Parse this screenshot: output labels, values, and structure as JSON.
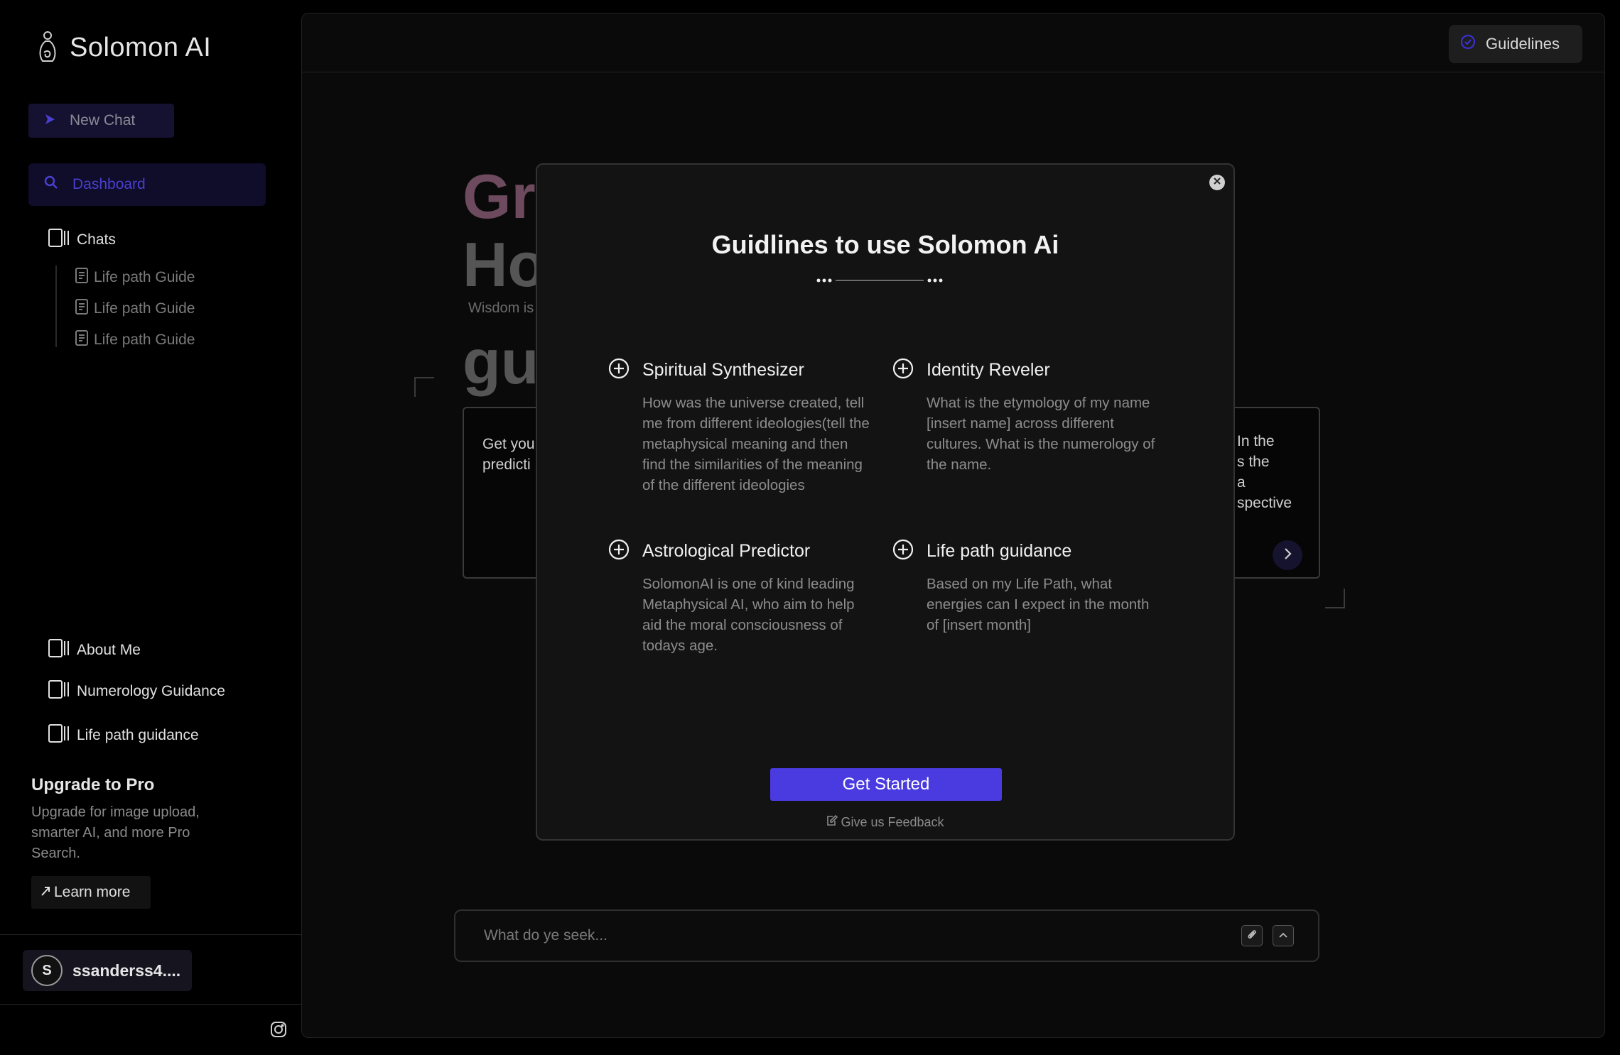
{
  "brand": {
    "title": "Solomon AI"
  },
  "sidebar": {
    "new_chat": "New Chat",
    "dashboard": "Dashboard",
    "chats_label": "Chats",
    "chat_items": [
      "Life path Guide",
      "Life path Guide",
      "Life path Guide"
    ],
    "bottom_items": [
      "About Me",
      "Numerology Guidance",
      "Life path guidance"
    ],
    "upgrade": {
      "title": "Upgrade to Pro",
      "description": "Upgrade for image upload, smarter AI, and more Pro Search.",
      "learn_more": "Learn more"
    },
    "user": {
      "initial": "S",
      "name": "ssanderss4...."
    }
  },
  "header": {
    "guidelines_button": "Guidelines"
  },
  "hero": {
    "line1": "Gr",
    "line2": "Ho",
    "subtitle": "Wisdom is",
    "line3": "gu"
  },
  "cards": {
    "left_text": "Get you\npredicti",
    "right_text": "In the\ns the\na\nspective"
  },
  "chat_input": {
    "placeholder": "What do ye seek..."
  },
  "modal": {
    "title": "Guidlines to use Solomon Ai",
    "features": [
      {
        "title": "Spiritual Synthesizer",
        "description": "How was the universe created, tell me from different ideologies(tell the metaphysical meaning  and then find the similarities of the meaning of the different ideologies"
      },
      {
        "title": "Identity Reveler",
        "description": "What is the etymology of my name [insert name] across different cultures. What is the numerology of the name."
      },
      {
        "title": "Astrological Predictor",
        "description": "SolomonAI is one of kind leading Metaphysical AI, who aim to help aid the moral consciousness of todays age."
      },
      {
        "title": "Life path guidance",
        "description": "Based on my Life Path, what energies can I expect in the month of [insert month]"
      }
    ],
    "get_started": "Get Started",
    "feedback": "Give us Feedback"
  },
  "colors": {
    "accent": "#4a3be0",
    "dashboard_text": "#4a3fcf",
    "background": "#000000",
    "panel": "#0a0a0a",
    "modal": "#131313"
  }
}
